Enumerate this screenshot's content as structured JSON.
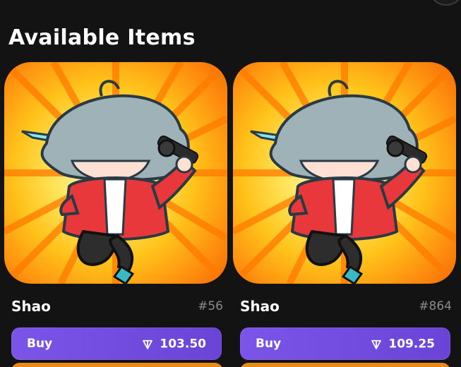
{
  "section": {
    "title": "Available Items"
  },
  "items": [
    {
      "name": "Shao",
      "number": "#56",
      "buy_label": "Buy",
      "price": "103.50",
      "currency_icon": "ton-diamond-icon"
    },
    {
      "name": "Shao",
      "number": "#864",
      "buy_label": "Buy",
      "price": "109.25",
      "currency_icon": "ton-diamond-icon"
    }
  ],
  "colors": {
    "background": "#131313",
    "button": "#6f4be0",
    "muted_text": "#8b8b8b",
    "art_orange": "#f26a06",
    "art_yellow": "#ffe45a"
  }
}
